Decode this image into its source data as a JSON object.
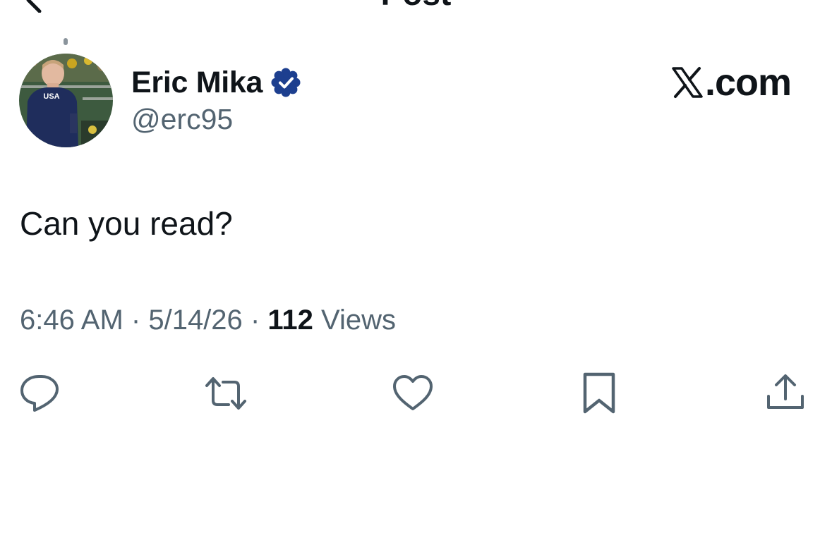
{
  "header": {
    "title": "Post",
    "back_icon": "back-arrow-icon"
  },
  "author": {
    "display_name": "Eric Mika",
    "handle": "@erc95",
    "verified": true,
    "verified_color": "#1d3f8f",
    "avatar_jersey_text": "USA"
  },
  "brand": {
    "logo_icon": "x-logo-icon",
    "site_text": ".com"
  },
  "post": {
    "text": "Can you read?",
    "time": "6:46 AM",
    "separator": "·",
    "date": "5/14/26",
    "views_count": "112",
    "views_label": "Views"
  },
  "actions": [
    {
      "name": "reply",
      "icon": "reply-icon"
    },
    {
      "name": "repost",
      "icon": "repost-icon"
    },
    {
      "name": "like",
      "icon": "heart-icon"
    },
    {
      "name": "bookmark",
      "icon": "bookmark-icon"
    },
    {
      "name": "share",
      "icon": "share-icon"
    }
  ],
  "colors": {
    "text_primary": "#0f1419",
    "text_secondary": "#536471",
    "icon": "#536471",
    "background": "#ffffff"
  }
}
